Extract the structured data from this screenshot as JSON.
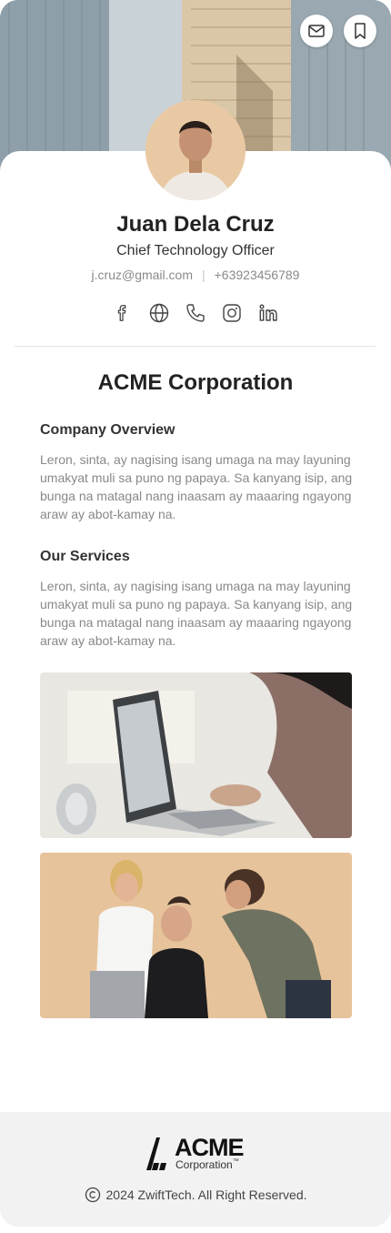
{
  "profile": {
    "name": "Juan Dela Cruz",
    "title": "Chief Technology Officer",
    "email": "j.cruz@gmail.com",
    "separator": "|",
    "phone": "+63923456789"
  },
  "header_actions": {
    "mail_icon": "mail-icon",
    "bookmark_icon": "bookmark-icon"
  },
  "socials": [
    "facebook-icon",
    "globe-icon",
    "phone-icon",
    "instagram-icon",
    "linkedin-icon"
  ],
  "company": {
    "name": "ACME Corporation",
    "overview_heading": "Company Overview",
    "overview_text": "Leron, sinta, ay nagising isang umaga na may layuning umakyat muli sa puno ng papaya. Sa kanyang isip, ang bunga na matagal nang inaasam ay maaaring ngayong araw ay abot-kamay na.",
    "services_heading": "Our Services",
    "services_text": "Leron, sinta, ay nagising isang umaga na may layuning umakyat muli sa puno ng papaya. Sa kanyang isip, ang bunga na matagal nang inaasam ay maaaring ngayong araw ay abot-kamay na."
  },
  "footer": {
    "logo_main": "ACME",
    "logo_sub": "Corporation",
    "logo_tm": "™",
    "copyright": "2024 ZwiftTech. All Right Reserved."
  },
  "colors": {
    "accent_text": "#222222",
    "muted_text": "#888888",
    "footer_bg": "#f2f2f2"
  }
}
